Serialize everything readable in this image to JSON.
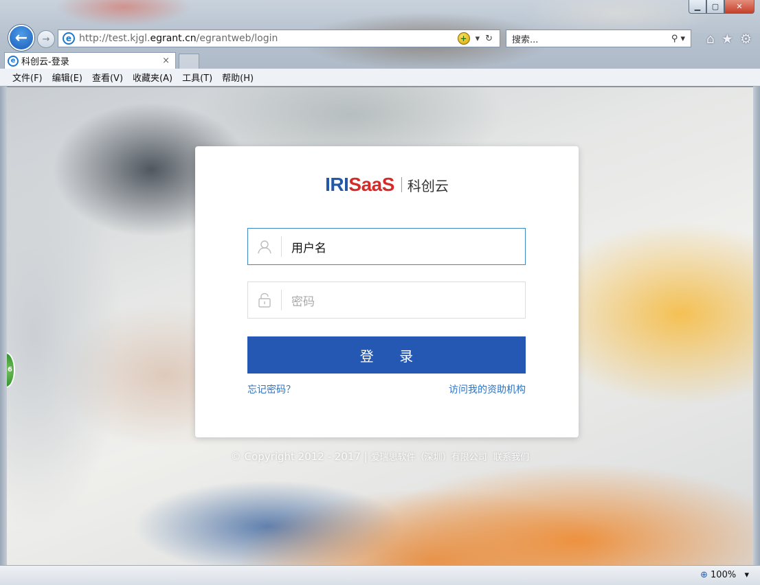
{
  "browser": {
    "url_prefix": "http://test.kjgl.",
    "url_host": "egrant.cn",
    "url_suffix": "/egrantweb/login",
    "search_placeholder": "搜索...",
    "tab_title": "科创云-登录",
    "tab_close": "×",
    "menu": [
      "文件(F)",
      "编辑(E)",
      "查看(V)",
      "收藏夹(A)",
      "工具(T)",
      "帮助(H)"
    ],
    "zoom": "100%",
    "icons": {
      "back": "back-arrow-icon",
      "forward": "forward-arrow-icon",
      "ie": "ie-logo-icon",
      "compat": "compatibility-view-icon",
      "search": "search-icon",
      "home": "home-icon",
      "favorites": "star-icon",
      "tools": "gear-icon"
    }
  },
  "login": {
    "logo_iri": "IRI",
    "logo_saas": "SaaS",
    "logo_cn": "科创云",
    "username_value": "用户名",
    "password_placeholder": "密码",
    "submit_label": "登 录",
    "forgot_password": "忘记密码？",
    "visit_funding": "访问我的资助机构"
  },
  "footer": {
    "copyright": "© Copyright 2012 - 2017 | ",
    "company": "爱瑞思软件（深圳）有限公司",
    "contact": "联系我们"
  },
  "side_widget": {
    "digit": "6"
  },
  "colors": {
    "brand_blue": "#2458b3",
    "brand_red": "#d42a2a",
    "link": "#2e72c0"
  }
}
